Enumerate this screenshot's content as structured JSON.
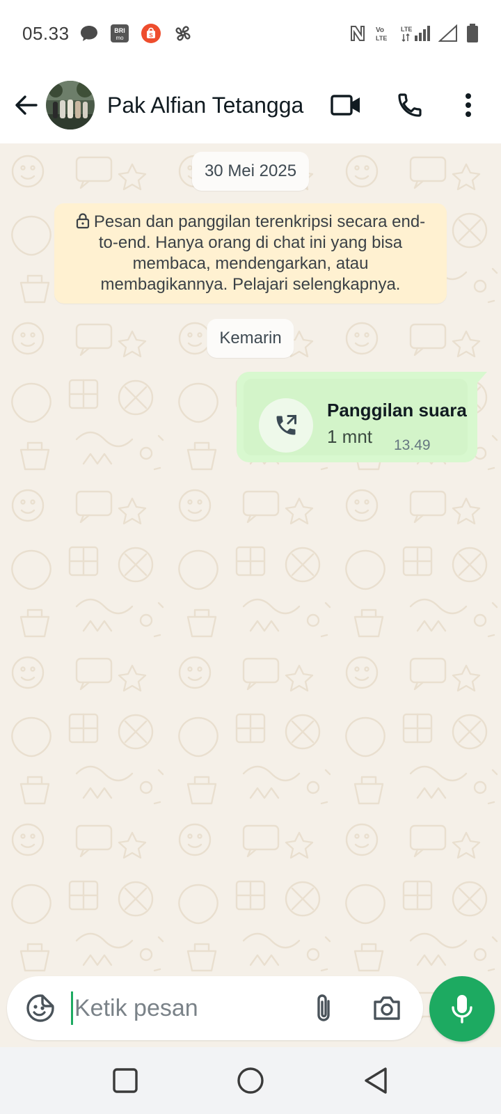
{
  "status_bar": {
    "time": "05.33",
    "left_icons": [
      "chat-bubble-icon",
      "brimo-icon",
      "shopee-icon",
      "pinwheel-icon"
    ],
    "right_icons": [
      "nfc-icon",
      "volte-icon",
      "lte-signal-icon",
      "signal-icon",
      "battery-icon"
    ],
    "brimo_label": "BRI mo"
  },
  "header": {
    "contact_name": "Pak Alfian Tetangga",
    "actions": [
      "video-call",
      "voice-call",
      "more-options"
    ]
  },
  "chat": {
    "date_1": "30 Mei 2025",
    "encryption_notice": "Pesan dan panggilan terenkripsi secara end-to-end. Hanya orang di chat ini yang bisa membaca, mendengarkan, atau membagikannya. Pelajari selengkapnya.",
    "date_2": "Kemarin",
    "call_message": {
      "title": "Panggilan suara",
      "duration": "1 mnt",
      "time": "13.49"
    }
  },
  "input": {
    "placeholder": "Ketik pesan"
  },
  "colors": {
    "accent": "#1daa61",
    "bubble_out": "#d8f8cf",
    "chat_bg": "#f5f0e8",
    "notice_bg": "#fff1d1"
  }
}
